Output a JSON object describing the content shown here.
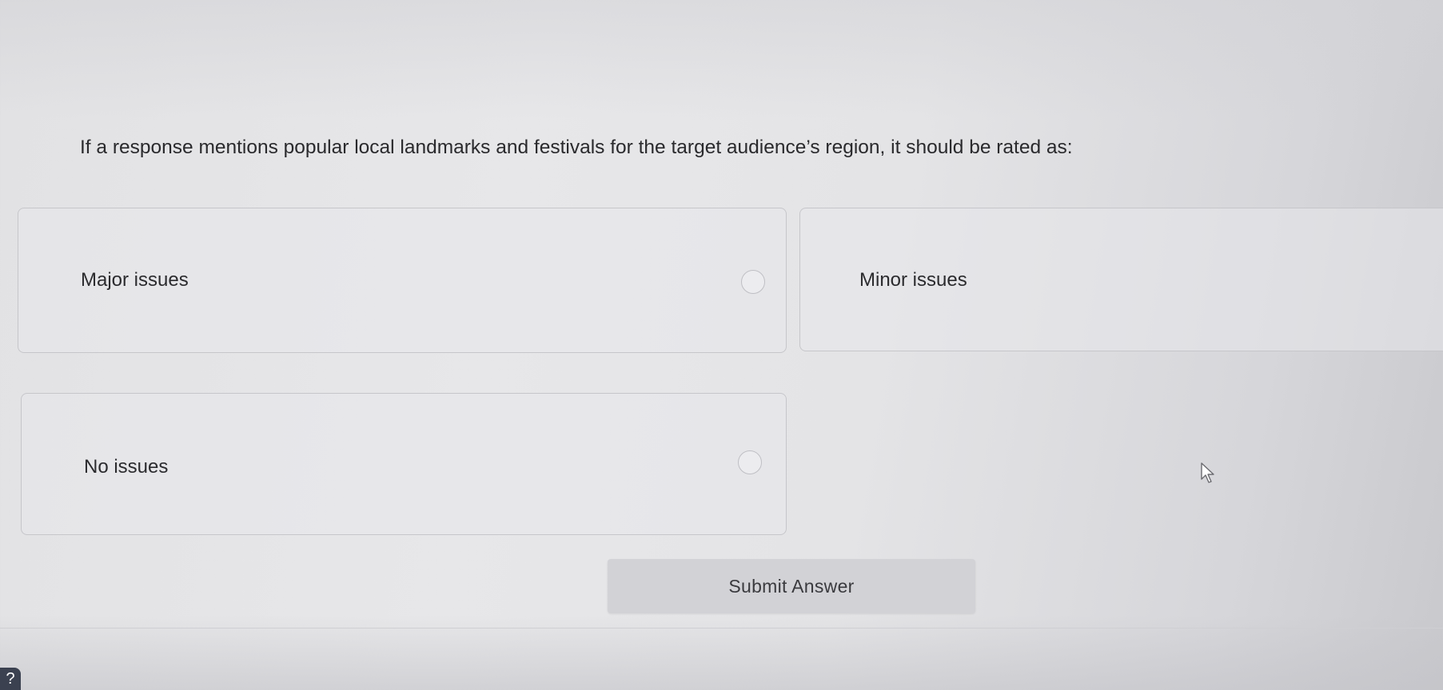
{
  "question": {
    "text": "If a response mentions popular local landmarks and festivals for the target audience’s region, it should be rated as:"
  },
  "options": [
    {
      "label": "Major issues",
      "selected": false
    },
    {
      "label": "Minor issues",
      "selected": false
    },
    {
      "label": "No issues",
      "selected": false
    }
  ],
  "actions": {
    "submit_label": "Submit Answer"
  },
  "help": {
    "icon_glyph": "?"
  },
  "icons": {
    "help": "help-icon",
    "cursor": "cursor-icon",
    "radio": "radio-icon"
  },
  "colors": {
    "background": "#e4e4e6",
    "option_border": "#c6c6ca",
    "submit_bg": "#d2d2d6",
    "help_bg": "#3b4150"
  }
}
